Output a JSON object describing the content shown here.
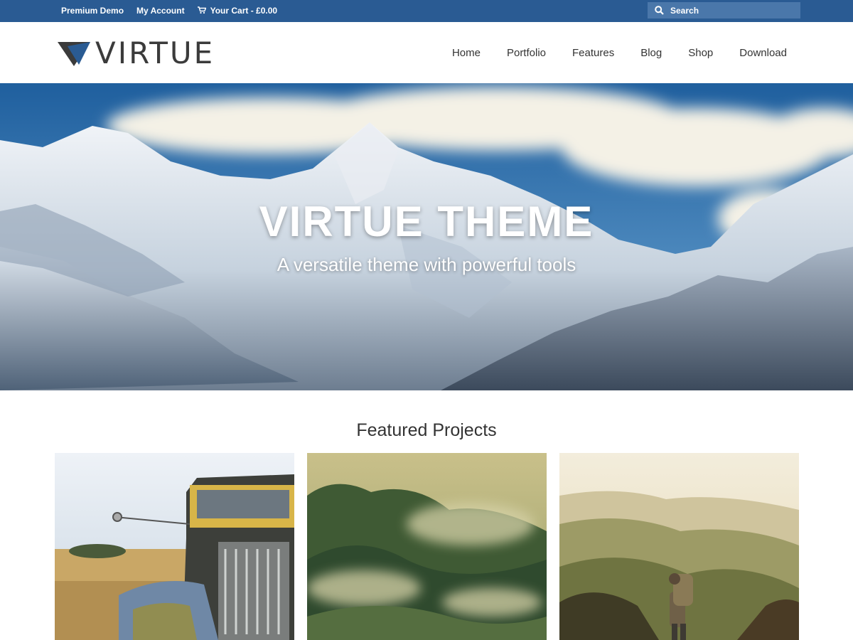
{
  "topbar": {
    "links": [
      "Premium Demo",
      "My Account"
    ],
    "cart_label": "Your Cart - £0.00",
    "search_placeholder": "Search"
  },
  "header": {
    "logo_text": "VIRTUE",
    "nav": [
      "Home",
      "Portfolio",
      "Features",
      "Blog",
      "Shop",
      "Download"
    ]
  },
  "hero": {
    "title": "VIRTUE THEME",
    "subtitle": "A versatile theme with powerful tools"
  },
  "featured": {
    "title": "Featured Projects",
    "projects": [
      {
        "image": "rusty-vintage-truck-in-field"
      },
      {
        "image": "misty-green-forest-hills"
      },
      {
        "image": "hiker-in-sunlit-mountains"
      }
    ]
  },
  "colors": {
    "topbar": "#2a5b93",
    "search_bg": "#4a77aa",
    "logo_triangle": "#2a5b93",
    "text": "#333333"
  }
}
